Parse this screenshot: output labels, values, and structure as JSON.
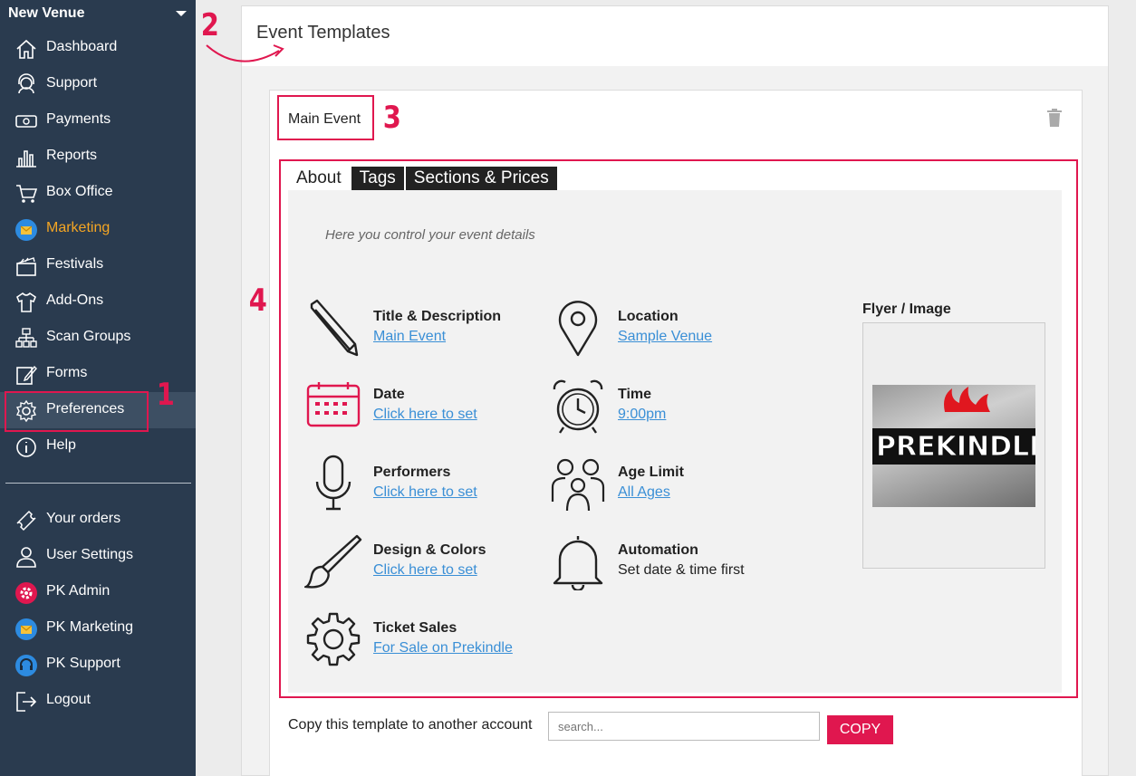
{
  "sidebar": {
    "venue": "New Venue",
    "items": [
      {
        "label": "Dashboard",
        "icon": "home-icon"
      },
      {
        "label": "Support",
        "icon": "headset-icon"
      },
      {
        "label": "Payments",
        "icon": "money-icon"
      },
      {
        "label": "Reports",
        "icon": "bar-chart-icon"
      },
      {
        "label": "Box Office",
        "icon": "cart-icon"
      },
      {
        "label": "Marketing",
        "icon": "envelope-badge-icon"
      },
      {
        "label": "Festivals",
        "icon": "clapperboard-icon"
      },
      {
        "label": "Add-Ons",
        "icon": "tshirt-icon"
      },
      {
        "label": "Scan Groups",
        "icon": "org-chart-icon"
      },
      {
        "label": "Forms",
        "icon": "form-edit-icon"
      },
      {
        "label": "Preferences",
        "icon": "gear-icon"
      },
      {
        "label": "Help",
        "icon": "info-icon"
      }
    ],
    "bottom_items": [
      {
        "label": "Your orders",
        "icon": "ticket-icon"
      },
      {
        "label": "User Settings",
        "icon": "user-icon"
      },
      {
        "label": "PK Admin",
        "icon": "admin-gear-badge-icon"
      },
      {
        "label": "PK Marketing",
        "icon": "envelope-badge-icon"
      },
      {
        "label": "PK Support",
        "icon": "headset-badge-icon"
      },
      {
        "label": "Logout",
        "icon": "logout-icon"
      }
    ]
  },
  "annotations": {
    "n1": "1",
    "n2": "2",
    "n3": "3",
    "n4": "4"
  },
  "page": {
    "title": "Event Templates"
  },
  "template": {
    "name": "Main Event",
    "tabs": [
      "About",
      "Tags",
      "Sections & Prices"
    ],
    "hint": "Here you control your event details",
    "fields": {
      "title": {
        "title": "Title & Description",
        "value": "Main Event"
      },
      "location": {
        "title": "Location",
        "value": "Sample Venue"
      },
      "date": {
        "title": "Date",
        "value": "Click here to set"
      },
      "time": {
        "title": "Time",
        "value": "9:00pm"
      },
      "performers": {
        "title": "Performers",
        "value": "Click here to set"
      },
      "age": {
        "title": "Age Limit",
        "value": "All Ages"
      },
      "design": {
        "title": "Design & Colors",
        "value": "Click here to set"
      },
      "automation": {
        "title": "Automation",
        "value": "Set date & time first"
      },
      "sales": {
        "title": "Ticket Sales",
        "value": "For Sale on Prekindle"
      }
    },
    "flyer": {
      "title": "Flyer / Image",
      "image_text": "PREKINDLE"
    }
  },
  "copy": {
    "label": "Copy this template to another account",
    "placeholder": "search...",
    "button": "COPY"
  },
  "colors": {
    "sidebar_bg": "#2a3b4f",
    "accent": "#e0174f",
    "link": "#3a8fd6",
    "marketing": "#f5a623"
  }
}
